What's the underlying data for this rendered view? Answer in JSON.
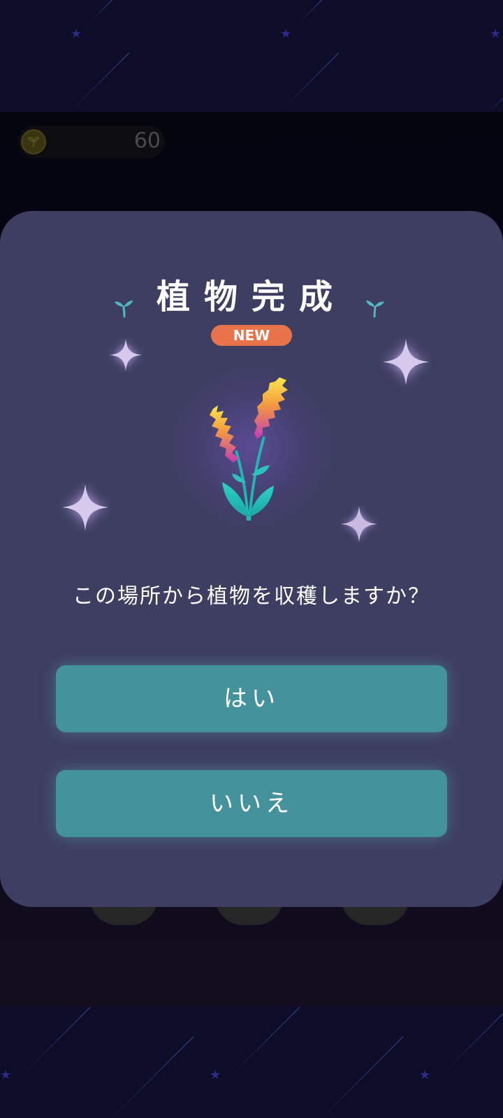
{
  "header": {
    "coin_count": "60"
  },
  "dialog": {
    "title": "植物完成",
    "badge": "NEW",
    "question": "この場所から植物を収穫しますか？",
    "yes_label": "はい",
    "no_label": "いいえ"
  },
  "icons": {
    "coin": "coin-icon",
    "sprout": "sprout-icon",
    "sparkle": "sparkle-icon",
    "plant": "flower-plant-icon"
  },
  "colors": {
    "modal_bg": "#3e3e62",
    "button_bg": "#44939c",
    "badge_bg": "#e8734a",
    "page_bg": "#0c0c24"
  }
}
